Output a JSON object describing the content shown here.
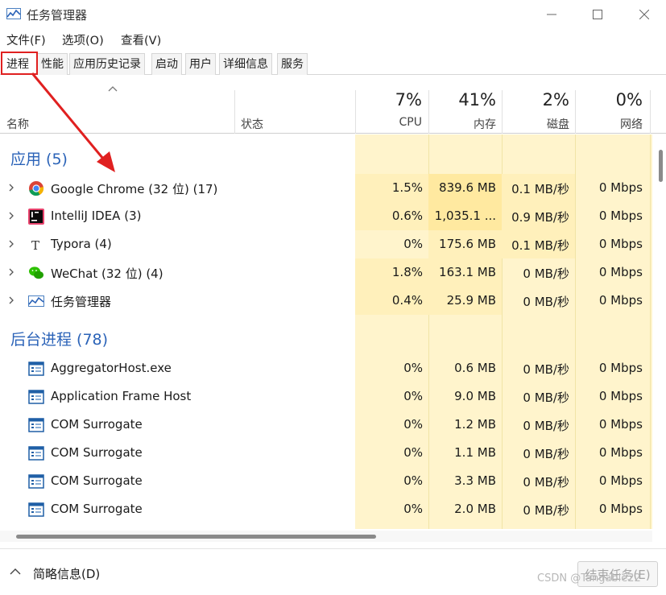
{
  "window": {
    "title": "任务管理器",
    "watermark": "CSDN @Tangable22"
  },
  "menu": [
    "文件(F)",
    "选项(O)",
    "查看(V)"
  ],
  "tabs": [
    "进程",
    "性能",
    "应用历史记录",
    "启动",
    "用户",
    "详细信息",
    "服务"
  ],
  "active_tab": "进程",
  "columns": {
    "name": "名称",
    "status": "状态",
    "cpu": {
      "label": "CPU",
      "pct": "7%"
    },
    "memory": {
      "label": "内存",
      "pct": "41%"
    },
    "disk": {
      "label": "磁盘",
      "pct": "2%"
    },
    "network": {
      "label": "网络",
      "pct": "0%"
    }
  },
  "groups": {
    "apps": "应用 (5)",
    "background": "后台进程 (78)"
  },
  "apps": [
    {
      "name": "Google Chrome (32 位) (17)",
      "icon": "chrome-icon",
      "cpu": "1.5%",
      "mem": "839.6 MB",
      "disk": "0.1 MB/秒",
      "net": "0 Mbps",
      "heat": {
        "cpu": 2,
        "mem": 3,
        "disk": 2,
        "net": 1
      }
    },
    {
      "name": "IntelliJ IDEA (3)",
      "icon": "intellij-icon",
      "cpu": "0.6%",
      "mem": "1,035.1 ...",
      "disk": "0.9 MB/秒",
      "net": "0 Mbps",
      "heat": {
        "cpu": 2,
        "mem": 3,
        "disk": 2,
        "net": 1
      }
    },
    {
      "name": "Typora (4)",
      "icon": "typora-icon",
      "cpu": "0%",
      "mem": "175.6 MB",
      "disk": "0.1 MB/秒",
      "net": "0 Mbps",
      "heat": {
        "cpu": 1,
        "mem": 2,
        "disk": 2,
        "net": 1
      }
    },
    {
      "name": "WeChat (32 位) (4)",
      "icon": "wechat-icon",
      "cpu": "1.8%",
      "mem": "163.1 MB",
      "disk": "0 MB/秒",
      "net": "0 Mbps",
      "heat": {
        "cpu": 2,
        "mem": 2,
        "disk": 1,
        "net": 1
      }
    },
    {
      "name": "任务管理器",
      "icon": "task-manager-icon",
      "cpu": "0.4%",
      "mem": "25.9 MB",
      "disk": "0 MB/秒",
      "net": "0 Mbps",
      "heat": {
        "cpu": 2,
        "mem": 2,
        "disk": 1,
        "net": 1
      }
    }
  ],
  "background": [
    {
      "name": "AggregatorHost.exe",
      "icon": "app-window-icon",
      "cpu": "0%",
      "mem": "0.6 MB",
      "disk": "0 MB/秒",
      "net": "0 Mbps"
    },
    {
      "name": "Application Frame Host",
      "icon": "app-window-icon",
      "cpu": "0%",
      "mem": "9.0 MB",
      "disk": "0 MB/秒",
      "net": "0 Mbps"
    },
    {
      "name": "COM Surrogate",
      "icon": "app-window-icon",
      "cpu": "0%",
      "mem": "1.2 MB",
      "disk": "0 MB/秒",
      "net": "0 Mbps"
    },
    {
      "name": "COM Surrogate",
      "icon": "app-window-icon",
      "cpu": "0%",
      "mem": "1.1 MB",
      "disk": "0 MB/秒",
      "net": "0 Mbps"
    },
    {
      "name": "COM Surrogate",
      "icon": "app-window-icon",
      "cpu": "0%",
      "mem": "3.3 MB",
      "disk": "0 MB/秒",
      "net": "0 Mbps"
    },
    {
      "name": "COM Surrogate",
      "icon": "app-window-icon",
      "cpu": "0%",
      "mem": "2.0 MB",
      "disk": "0 MB/秒",
      "net": "0 Mbps"
    }
  ],
  "footer": {
    "summary_label": "简略信息(D)",
    "end_task_label": "结束任务(E)"
  },
  "colors": {
    "heat_base": "#fff4cc",
    "heat_2": "#fff0bb",
    "heat_3": "#ffe9a0",
    "group_blue": "#2b63b8",
    "annotation_red": "#e02020"
  }
}
